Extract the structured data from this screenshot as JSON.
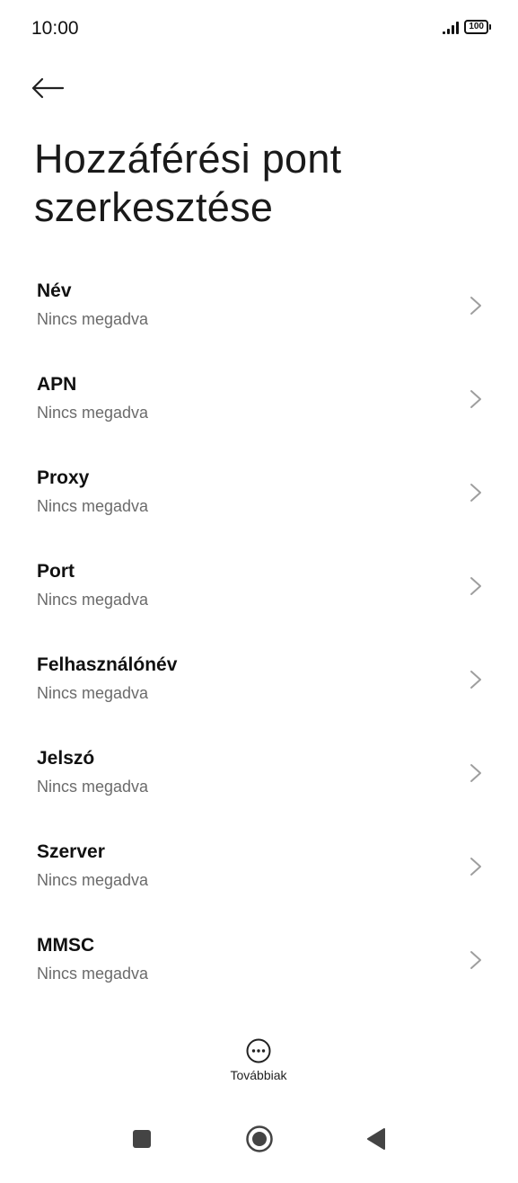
{
  "status_bar": {
    "time": "10:00",
    "battery": "100"
  },
  "header": {
    "back_icon": "arrow-left-icon",
    "title": "Hozzáférési pont szerkesztése"
  },
  "settings": {
    "items": [
      {
        "label": "Név",
        "value": "Nincs megadva"
      },
      {
        "label": "APN",
        "value": "Nincs megadva"
      },
      {
        "label": "Proxy",
        "value": "Nincs megadva"
      },
      {
        "label": "Port",
        "value": "Nincs megadva"
      },
      {
        "label": "Felhasználónév",
        "value": "Nincs megadva"
      },
      {
        "label": "Jelszó",
        "value": "Nincs megadva"
      },
      {
        "label": "Szerver",
        "value": "Nincs megadva"
      },
      {
        "label": "MMSC",
        "value": "Nincs megadva"
      }
    ]
  },
  "bottom_action": {
    "icon": "more-dots-icon",
    "label": "Továbbiak"
  },
  "nav_bar": {
    "recents_icon": "square-icon",
    "home_icon": "circle-icon",
    "back_icon": "triangle-back-icon"
  },
  "colors": {
    "background": "#ffffff",
    "primary_text": "#111111",
    "secondary_text": "#6b6b6b",
    "chevron": "#9e9e9e"
  }
}
